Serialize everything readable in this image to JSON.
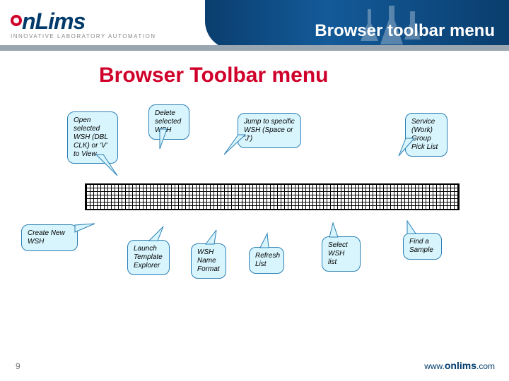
{
  "header": {
    "logo_text": "nLims",
    "logo_tagline": "INNOVATIVE LABORATORY AUTOMATION",
    "title": "Browser toolbar menu"
  },
  "page_title": "Browser Toolbar menu",
  "callouts": {
    "open": "Open selected WSH\n (DBL CLK) or 'V' to View",
    "delete": "Delete selected WSH",
    "jump": "Jump to specific WSH (Space or 'J')",
    "service": "Service (Work) Group Pick List",
    "create": "Create New WSH",
    "launch": "Launch Template Explorer",
    "format": "WSH Name Format",
    "refresh": "Refresh List",
    "select": "Select WSH list",
    "find": "Find a Sample"
  },
  "page_number": "9",
  "footer": {
    "pre": "www.",
    "mid": "onlims",
    "post": ".com"
  }
}
